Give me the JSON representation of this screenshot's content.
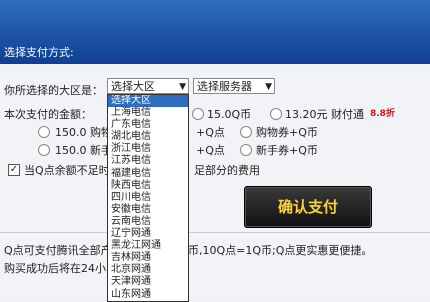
{
  "header": {
    "title": "选择支付方式:"
  },
  "region": {
    "label": "你所选择的大区是：",
    "region_select": "选择大区",
    "server_select": "选择服务器"
  },
  "amount": {
    "label": "本次支付的金额：",
    "row1": [
      {
        "text": "15.0Q币"
      },
      {
        "text": "13.20元  财付通"
      }
    ],
    "badge": "8.8折",
    "row2": [
      {
        "text": "150.0 购物"
      },
      {
        "text": "+Q点"
      },
      {
        "text": "购物券+Q币"
      }
    ],
    "row3": [
      {
        "text": "150.0 新手"
      },
      {
        "text": "+Q点"
      },
      {
        "text": "新手券+Q币"
      }
    ]
  },
  "option": {
    "checkbox_checked": true,
    "text_left": "当Q点余额不足时",
    "text_right": "足部分的费用"
  },
  "pay_button": {
    "label": "确认支付"
  },
  "notes": {
    "line1_left": "Q点可支付腾讯全部产",
    "line1_right": "币,10Q点=1Q币;Q点更实惠更便捷。",
    "line2_left": "购买成功后将在24小"
  },
  "dropdown": {
    "selected_index": 0,
    "items": [
      "选择大区",
      "上海电信",
      "广东电信",
      "湖北电信",
      "浙江电信",
      "江苏电信",
      "福建电信",
      "陕西电信",
      "四川电信",
      "安徽电信",
      "云南电信",
      "辽宁网通",
      "黑龙江网通",
      "吉林网通",
      "北京网通",
      "天津网通",
      "山东网通"
    ]
  },
  "colors": {
    "header": "#1f5aae",
    "pay_text": "#ffd23a",
    "badge": "#d4171c"
  }
}
